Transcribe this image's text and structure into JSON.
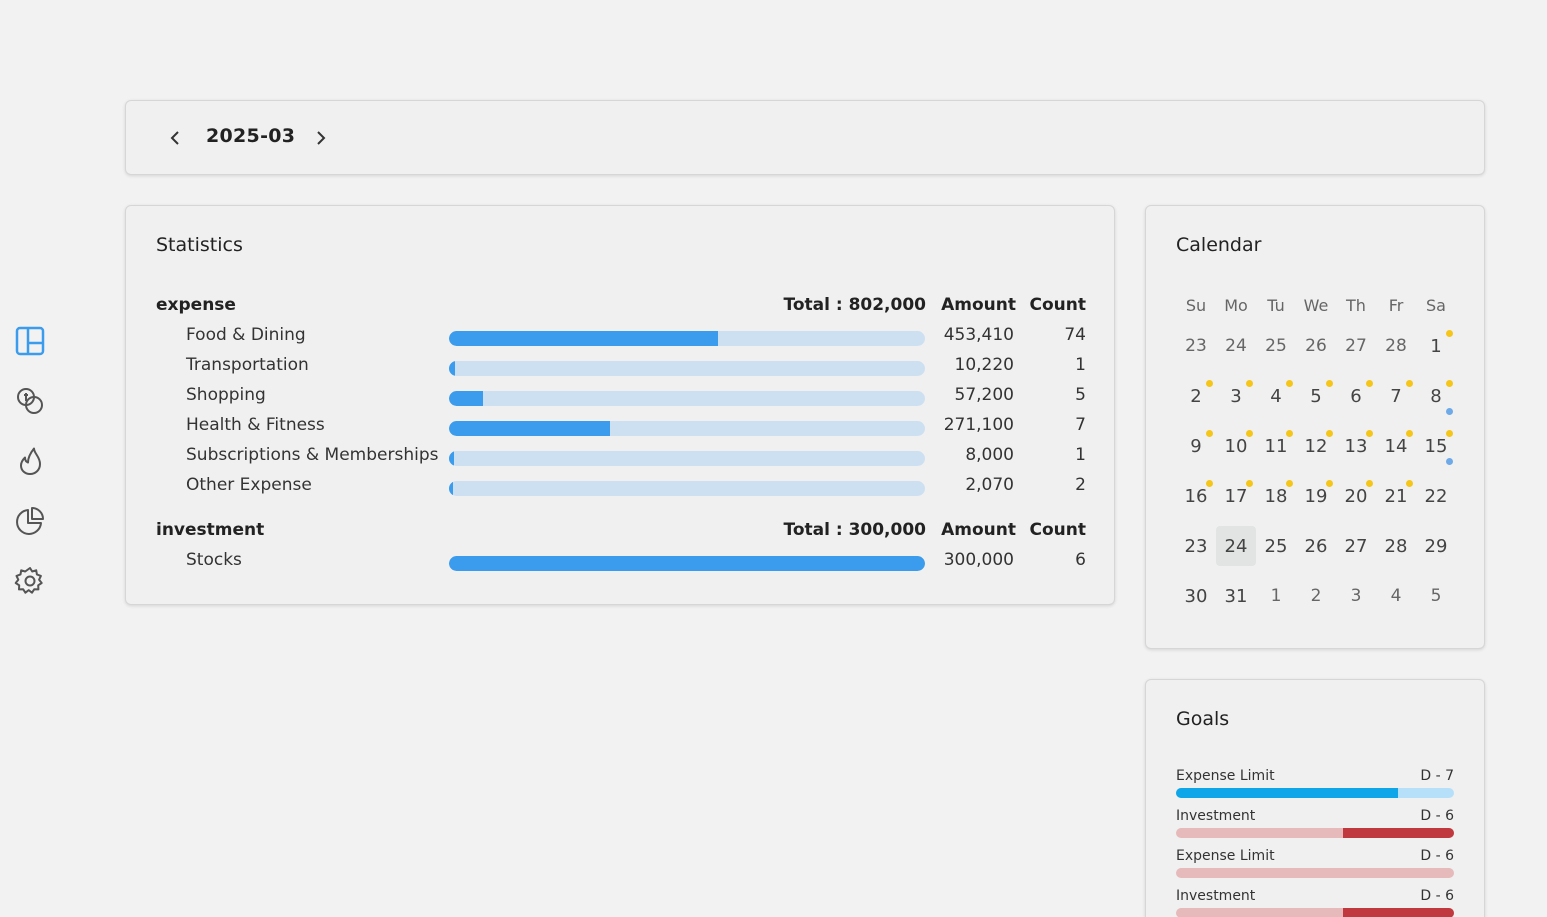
{
  "sidebar": {
    "items": [
      {
        "name": "dashboard",
        "icon": "layout-icon",
        "active": true
      },
      {
        "name": "transactions",
        "icon": "coins-icon",
        "active": false
      },
      {
        "name": "goals",
        "icon": "flame-icon",
        "active": false
      },
      {
        "name": "reports",
        "icon": "pie-chart-icon",
        "active": false
      },
      {
        "name": "settings",
        "icon": "gear-icon",
        "active": false
      }
    ]
  },
  "month_nav": {
    "label": "2025-03",
    "prev_icon": "chevron-left-icon",
    "next_icon": "chevron-right-icon"
  },
  "statistics": {
    "title": "Statistics",
    "groups": [
      {
        "name": "expense",
        "total": "Total : 802,000",
        "amount_header": "Amount",
        "count_header": "Count",
        "rows": [
          {
            "name": "Food & Dining",
            "amount": "453,410",
            "count": "74",
            "fraction": 0.565
          },
          {
            "name": "Transportation",
            "amount": "10,220",
            "count": "1",
            "fraction": 0.013
          },
          {
            "name": "Shopping",
            "amount": "57,200",
            "count": "5",
            "fraction": 0.071
          },
          {
            "name": "Health & Fitness",
            "amount": "271,100",
            "count": "7",
            "fraction": 0.338
          },
          {
            "name": "Subscriptions & Memberships",
            "amount": "8,000",
            "count": "1",
            "fraction": 0.01
          },
          {
            "name": "Other Expense",
            "amount": "2,070",
            "count": "2",
            "fraction": 0.003
          }
        ]
      },
      {
        "name": "investment",
        "total": "Total : 300,000",
        "amount_header": "Amount",
        "count_header": "Count",
        "rows": [
          {
            "name": "Stocks",
            "amount": "300,000",
            "count": "6",
            "fraction": 1.0
          }
        ]
      }
    ]
  },
  "calendar": {
    "title": "Calendar",
    "weekdays": [
      "Su",
      "Mo",
      "Tu",
      "We",
      "Th",
      "Fr",
      "Sa"
    ],
    "today": "24",
    "weeks": [
      [
        {
          "d": "23",
          "o": true
        },
        {
          "d": "24",
          "o": true
        },
        {
          "d": "25",
          "o": true
        },
        {
          "d": "26",
          "o": true
        },
        {
          "d": "27",
          "o": true
        },
        {
          "d": "28",
          "o": true
        },
        {
          "d": "1",
          "y": true
        }
      ],
      [
        {
          "d": "2",
          "y": true
        },
        {
          "d": "3",
          "y": true
        },
        {
          "d": "4",
          "y": true
        },
        {
          "d": "5",
          "y": true
        },
        {
          "d": "6",
          "y": true
        },
        {
          "d": "7",
          "y": true
        },
        {
          "d": "8",
          "y": true,
          "b": true
        }
      ],
      [
        {
          "d": "9",
          "y": true
        },
        {
          "d": "10",
          "y": true
        },
        {
          "d": "11",
          "y": true
        },
        {
          "d": "12",
          "y": true
        },
        {
          "d": "13",
          "y": true
        },
        {
          "d": "14",
          "y": true
        },
        {
          "d": "15",
          "y": true,
          "b": true
        }
      ],
      [
        {
          "d": "16",
          "y": true
        },
        {
          "d": "17",
          "y": true
        },
        {
          "d": "18",
          "y": true
        },
        {
          "d": "19",
          "y": true
        },
        {
          "d": "20",
          "y": true
        },
        {
          "d": "21",
          "y": true
        },
        {
          "d": "22"
        }
      ],
      [
        {
          "d": "23"
        },
        {
          "d": "24",
          "today": true
        },
        {
          "d": "25"
        },
        {
          "d": "26"
        },
        {
          "d": "27"
        },
        {
          "d": "28"
        },
        {
          "d": "29"
        }
      ],
      [
        {
          "d": "30"
        },
        {
          "d": "31"
        },
        {
          "d": "1",
          "o": true
        },
        {
          "d": "2",
          "o": true
        },
        {
          "d": "3",
          "o": true
        },
        {
          "d": "4",
          "o": true
        },
        {
          "d": "5",
          "o": true
        }
      ]
    ],
    "colors": {
      "expense_dot": "#f5c518",
      "investment_dot": "#6ea9e8"
    }
  },
  "goals": {
    "title": "Goals",
    "items": [
      {
        "label": "Expense Limit",
        "dday": "D - 7",
        "progress": 0.8,
        "track_color": "#b6e0fa",
        "fill_color": "#0ea5e9",
        "fill_from": "left"
      },
      {
        "label": "Investment",
        "dday": "D - 6",
        "progress": 0.4,
        "track_color": "#e6b9bb",
        "fill_color": "#c0393f",
        "fill_from": "right"
      },
      {
        "label": "Expense Limit",
        "dday": "D - 6",
        "progress": 0.0,
        "track_color": "#e6b9bb",
        "fill_color": "#c0393f",
        "fill_from": "right"
      },
      {
        "label": "Investment",
        "dday": "D - 6",
        "progress": 0.4,
        "track_color": "#e6b9bb",
        "fill_color": "#c0393f",
        "fill_from": "right"
      }
    ]
  }
}
